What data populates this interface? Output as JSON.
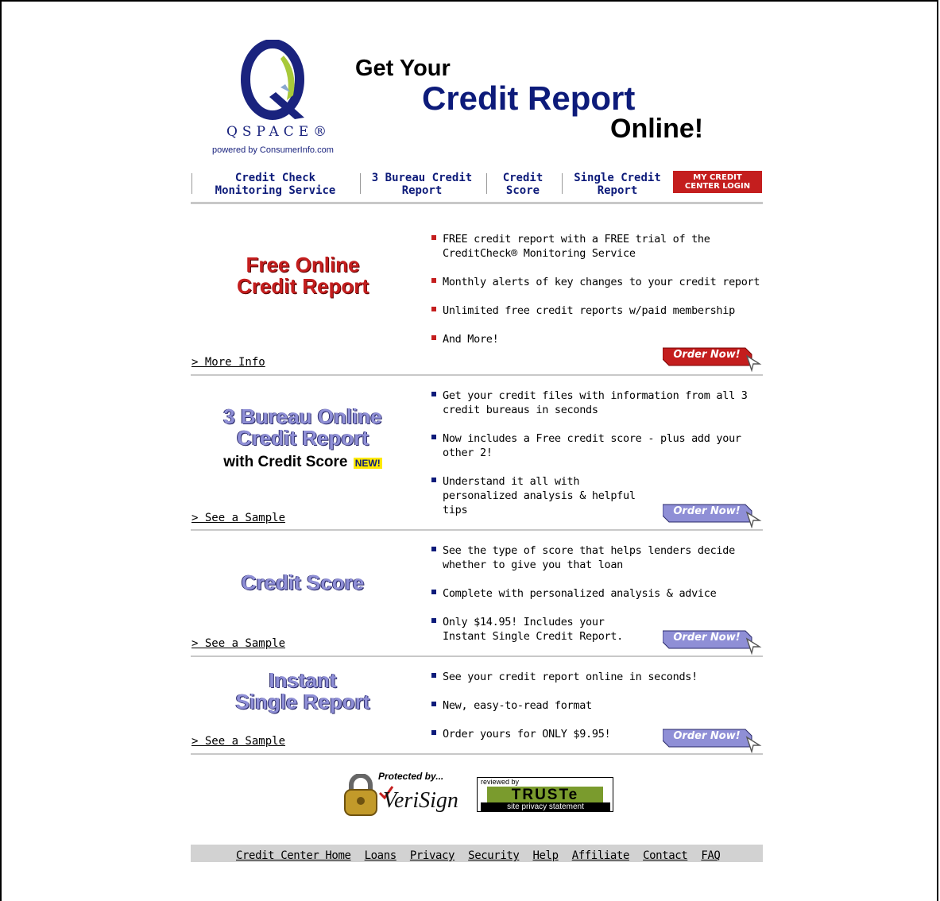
{
  "header": {
    "logo_word": "QSPACE®",
    "logo_sub": "powered by ConsumerInfo.com",
    "headline_1": "Get Your",
    "headline_2": "Credit Report",
    "headline_3": "Online!"
  },
  "nav": {
    "items": [
      {
        "line1": "Credit Check",
        "line2": "Monitoring Service"
      },
      {
        "line1": "3 Bureau Credit",
        "line2": "Report"
      },
      {
        "line1": "Credit",
        "line2": "Score"
      },
      {
        "line1": "Single Credit",
        "line2": "Report"
      }
    ],
    "login_line1": "MY CREDIT",
    "login_line2": "CENTER LOGIN"
  },
  "sections": [
    {
      "title_1": "Free Online",
      "title_2": "Credit Report",
      "link": "> More Info",
      "bullets": [
        "FREE credit report with a FREE trial of the CreditCheck® Monitoring Service",
        "Monthly alerts of key changes to your credit report",
        "Unlimited free credit reports w/paid membership",
        "And More!"
      ],
      "order": "Order Now!",
      "color": "#c41e1e"
    },
    {
      "title_1": "3 Bureau Online",
      "title_2": "Credit Report",
      "title_3": "with Credit Score",
      "badge": "NEW!",
      "link": "> See a Sample",
      "bullets": [
        "Get your credit files with information from all 3 credit bureaus in seconds",
        "Now includes a Free credit score - plus add your other 2!",
        "Understand it all with personalized analysis & helpful tips"
      ],
      "order": "Order Now!",
      "color": "#8f8fd6"
    },
    {
      "title_1": "Credit Score",
      "link": "> See a Sample",
      "bullets": [
        "See the type of score that helps lenders decide whether to give you that loan",
        "Complete with personalized analysis & advice",
        "Only $14.95! Includes your Instant Single Credit Report."
      ],
      "order": "Order Now!",
      "color": "#8f8fd6"
    },
    {
      "title_1": "Instant",
      "title_2": "Single Report",
      "link": "> See a Sample",
      "bullets": [
        "See your credit report online in seconds!",
        "New, easy-to-read format",
        "Order yours for ONLY $9.95!"
      ],
      "order": "Order Now!",
      "color": "#8f8fd6"
    }
  ],
  "badges": {
    "verisign_protected": "Protected by...",
    "verisign_word": "VeriSign",
    "truste_reviewed": "reviewed by",
    "truste_word": "TRUSTe",
    "truste_statement": "site privacy statement"
  },
  "footer": {
    "links": [
      "Credit Center Home",
      "Loans",
      "Privacy",
      "Security",
      "Help",
      "Affiliate",
      "Contact",
      "FAQ"
    ]
  }
}
